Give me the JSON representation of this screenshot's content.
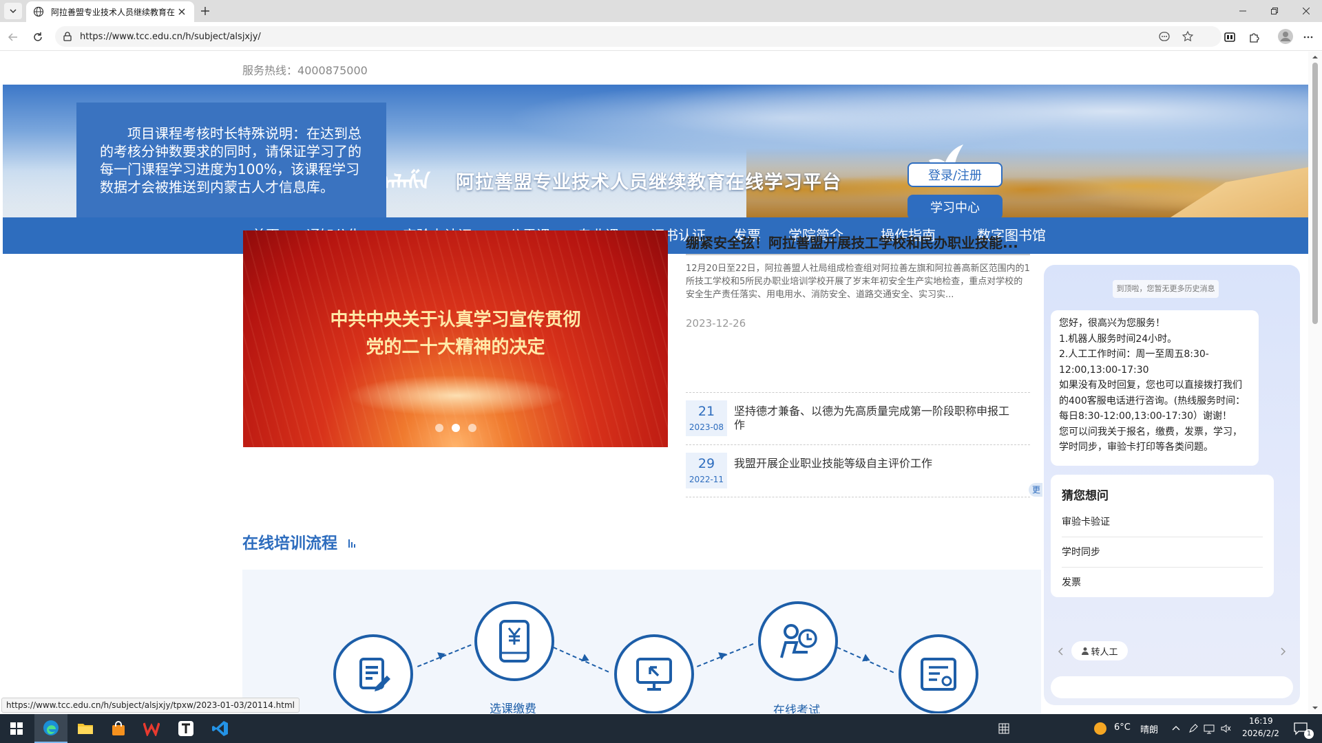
{
  "browser": {
    "tab_title": "阿拉善盟专业技术人员继续教育在",
    "url": "https://www.tcc.edu.cn/h/subject/alsjxjy/",
    "status_url": "https://www.tcc.edu.cn/h/subject/alsjxjy/tpxw/2023-01-03/20114.html"
  },
  "header": {
    "hotline_label": "服务热线：",
    "hotline_number": "4000875000",
    "mongolian_script": "ᠠᠯᠠᠱᠠ",
    "site_title": "阿拉善盟专业技术人员继续教育在线学习平台",
    "login_label": "登录/注册",
    "study_center_label": "学习中心"
  },
  "notice": {
    "text": "项目课程考核时长特殊说明：在达到总的考核分钟数要求的同时，请保证学习了的每一门课程学习进度为100%，该课程学习数据才会被推送到内蒙古人才信息库。"
  },
  "nav": {
    "items": [
      {
        "label": "首页",
        "id": "home"
      },
      {
        "label": "通知公告",
        "id": "notices"
      },
      {
        "label": "审验卡认证",
        "id": "card-verify"
      },
      {
        "label": "公需课",
        "id": "public-course"
      },
      {
        "label": "专业课",
        "id": "major-course"
      },
      {
        "label": "证书认证",
        "id": "certificate"
      },
      {
        "label": "发票",
        "id": "invoice"
      },
      {
        "label": "学院简介",
        "id": "about"
      },
      {
        "label": "操作指南",
        "id": "guide"
      },
      {
        "label": "数字图书馆",
        "id": "library"
      }
    ]
  },
  "carousel": {
    "title_line1": "中共中央关于认真学习宣传贯彻",
    "title_line2": "党的二十大精神的决定",
    "slide_count": 3,
    "active_index": 1
  },
  "news": {
    "headline": "绷紧安全弦！阿拉善盟开展技工学校和民办职业技能...",
    "summary": "12月20日至22日，阿拉善盟人社局组成检查组对阿拉善左旗和阿拉善高新区范围内的1所技工学校和5所民办职业培训学校开展了岁末年初安全生产实地检查，重点对学校的安全生产责任落实、用电用水、消防安全、道路交通安全、实习实...",
    "date": "2023-12-26",
    "items": [
      {
        "day": "21",
        "ym": "2023-08",
        "title": "坚持德才兼备、以德为先高质量完成第一阶段职称申报工作"
      },
      {
        "day": "29",
        "ym": "2022-11",
        "title": "我盟开展企业职业技能等级自主评价工作"
      }
    ],
    "more_label": "更多"
  },
  "training": {
    "section_title": "在线培训流程",
    "steps": [
      {
        "label": "",
        "icon": "edit-document-icon"
      },
      {
        "label": "选课缴费",
        "icon": "yuan-phone-icon"
      },
      {
        "label": "",
        "icon": "monitor-arrow-icon"
      },
      {
        "label": "在线考试",
        "icon": "exam-person-icon"
      },
      {
        "label": "",
        "icon": "certificate-icon"
      }
    ]
  },
  "chat": {
    "history_hint": "到顶啦，您暂无更多历史消息",
    "greeting_lines": [
      "您好，很高兴为您服务！",
      "1.机器人服务时间24小时。",
      "2.人工工作时间：周一至周五8:30-12:00,13:00-17:30",
      "如果没有及时回复，您也可以直接拨打我们的400客服电话进行咨询。(热线服务时间：每日8:30-12:00,13:00-17:30）谢谢！",
      "您可以问我关于报名，缴费，发票，学习，学时同步，审验卡打印等各类问题。"
    ],
    "guess_title": "猜您想问",
    "guess_items": [
      "审验卡验证",
      "学时同步",
      "发票"
    ],
    "transfer_label": "转人工",
    "input_placeholder": ""
  },
  "taskbar": {
    "weather_temp": "6°C",
    "weather_desc": "晴朗",
    "time": "16:19",
    "date": "2026/2/2",
    "notification_count": "1"
  },
  "colors": {
    "brand_blue": "#2e6dbe",
    "notice_blue": "#3a73c0",
    "flow_blue": "#1d5ea8"
  }
}
